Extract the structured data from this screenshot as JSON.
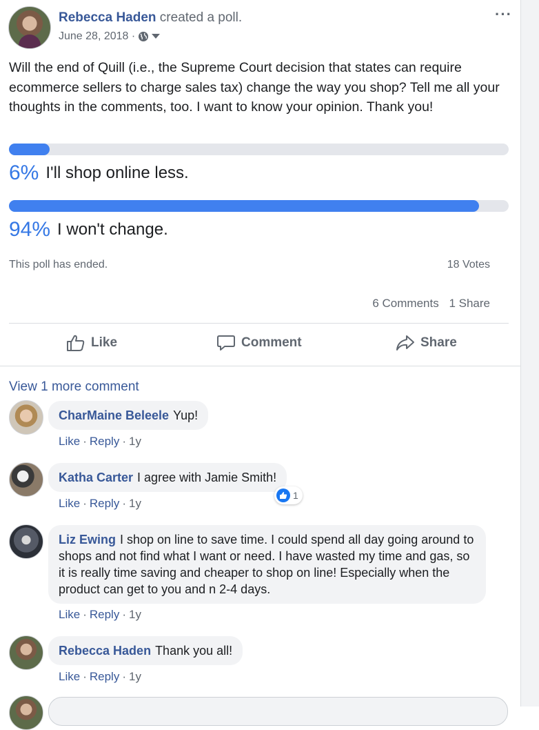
{
  "post": {
    "author": "Rebecca Haden",
    "action": "created a poll.",
    "date": "June 28, 2018 ·",
    "more_label": "···",
    "text": "Will the end of Quill (i.e., the Supreme Court decision that states can require ecommerce sellers to charge sales tax) change the way you shop? Tell me all your thoughts in the comments, too. I want to know your opinion. Thank you!",
    "icons": {
      "privacy": "globe-icon",
      "dropdown": "caret-down-icon"
    }
  },
  "poll": {
    "options": [
      {
        "percent_label": "6%",
        "fraction": 0.06,
        "label": "I'll shop online less."
      },
      {
        "percent_label": "94%",
        "fraction": 0.94,
        "label": "I won't change."
      }
    ],
    "status": "This poll has ended.",
    "votes": "18 Votes",
    "bar_color": "#4080ef",
    "track_color": "#e4e6eb"
  },
  "stats": {
    "comments": "6 Comments",
    "shares": "1 Share"
  },
  "actions": {
    "like": "Like",
    "comment": "Comment",
    "share": "Share"
  },
  "comments_section": {
    "view_more": "View 1 more comment",
    "comments": [
      {
        "name": "CharMaine Beleele",
        "text": "Yup!",
        "like": "Like",
        "reply": "Reply",
        "time": "1y"
      },
      {
        "name": "Katha Carter",
        "text": "I agree with Jamie Smith!",
        "like": "Like",
        "reply": "Reply",
        "time": "1y",
        "reactions": "1"
      },
      {
        "name": "Liz Ewing",
        "text": "I shop on line to save time. I could spend all day going around to shops and not find what I want or need. I have wasted my time and gas, so it is really time saving and cheaper to shop on line! Especially when the product can get to you and n 2-4 days.",
        "like": "Like",
        "reply": "Reply",
        "time": "1y"
      },
      {
        "name": "Rebecca Haden",
        "text": "Thank you all!",
        "like": "Like",
        "reply": "Reply",
        "time": "1y"
      }
    ]
  },
  "colors": {
    "link": "#385898",
    "accent": "#3578e5",
    "muted": "#606770"
  }
}
